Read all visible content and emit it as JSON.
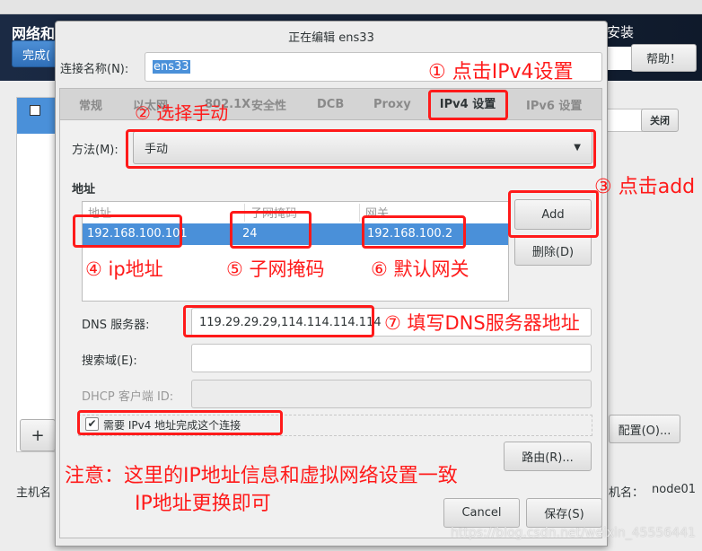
{
  "background": {
    "header_title": "网络和",
    "header_right": "安装",
    "done_button": "完成(",
    "help_button": "帮助！",
    "off_button": "关闭",
    "add_button": "+",
    "configure_button": "配置(O)...",
    "hostname_label": "主机名",
    "current_hostname_label": "机名：",
    "current_hostname_value": "node01"
  },
  "dialog": {
    "title": "正在编辑 ens33",
    "connection_name_label": "连接名称(N):",
    "connection_name_value": "ens33",
    "tabs": [
      {
        "label": "常规"
      },
      {
        "label": "以太网"
      },
      {
        "label": "802.1X"
      },
      {
        "label": "安全性"
      },
      {
        "label": "DCB"
      },
      {
        "label": "Proxy"
      },
      {
        "label": "IPv4 设置",
        "selected": true
      },
      {
        "label": "IPv6 设置"
      }
    ],
    "method_label": "方法(M):",
    "method_value": "手动",
    "address_section": "地址",
    "table": {
      "columns": [
        "地址",
        "子网掩码",
        "网关"
      ],
      "rows": [
        [
          "192.168.100.101",
          "24",
          "192.168.100.2"
        ]
      ]
    },
    "add_button": "Add",
    "delete_button": "删除(D)",
    "dns_label": "DNS 服务器:",
    "dns_value": "119.29.29.29,114.114.114.114",
    "search_label": "搜索域(E):",
    "search_value": "",
    "dhcp_label": "DHCP 客户端 ID:",
    "dhcp_value": "",
    "require_ipv4_label": "需要 IPv4 地址完成这个连接",
    "require_ipv4_checked": true,
    "routes_button": "路由(R)...",
    "cancel_button": "Cancel",
    "save_button": "保存(S)"
  },
  "annotations": {
    "step1": "① 点击IPv4设置",
    "step2": "② 选择手动",
    "step3": "③ 点击add",
    "step4": "④ ip地址",
    "step5": "⑤ 子网掩码",
    "step6": "⑥ 默认网关",
    "step7": "⑦ 填写DNS服务器地址",
    "note_line1": "注意：这里的IP地址信息和虚拟网络设置一致",
    "note_line2": "IP地址更换即可"
  },
  "watermark": "https://blog.csdn.net/weixin_45556441",
  "colors": {
    "accent": "#4a90d9",
    "header": "#1c2a3e",
    "annotation": "#ff1a1a"
  }
}
